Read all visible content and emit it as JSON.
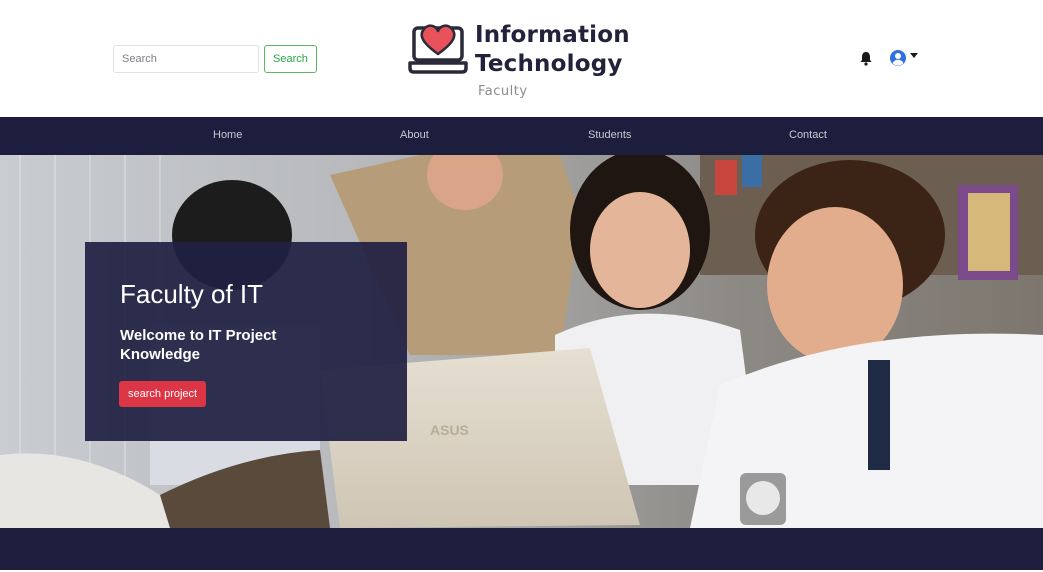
{
  "header": {
    "search": {
      "placeholder": "Search",
      "value": "",
      "button_label": "Search"
    },
    "logo": {
      "line1": "Information",
      "line2": "Technology",
      "subtitle": "Faculty"
    },
    "icons": {
      "notifications": "bell-icon",
      "user": "user-circle-icon",
      "caret": "caret-down-icon"
    }
  },
  "nav": {
    "items": [
      {
        "label": "Home"
      },
      {
        "label": "About"
      },
      {
        "label": "Students"
      },
      {
        "label": "Contact"
      }
    ]
  },
  "hero": {
    "title": "Faculty of IT",
    "subtitle": "Welcome to IT Project Knowledge",
    "button_label": "search project",
    "laptop_brand": "ASUS"
  },
  "colors": {
    "navy": "#1d1d3d",
    "card": "#202042",
    "danger": "#dc3545",
    "success": "#28a745",
    "logo_heart": "#e8525a"
  }
}
